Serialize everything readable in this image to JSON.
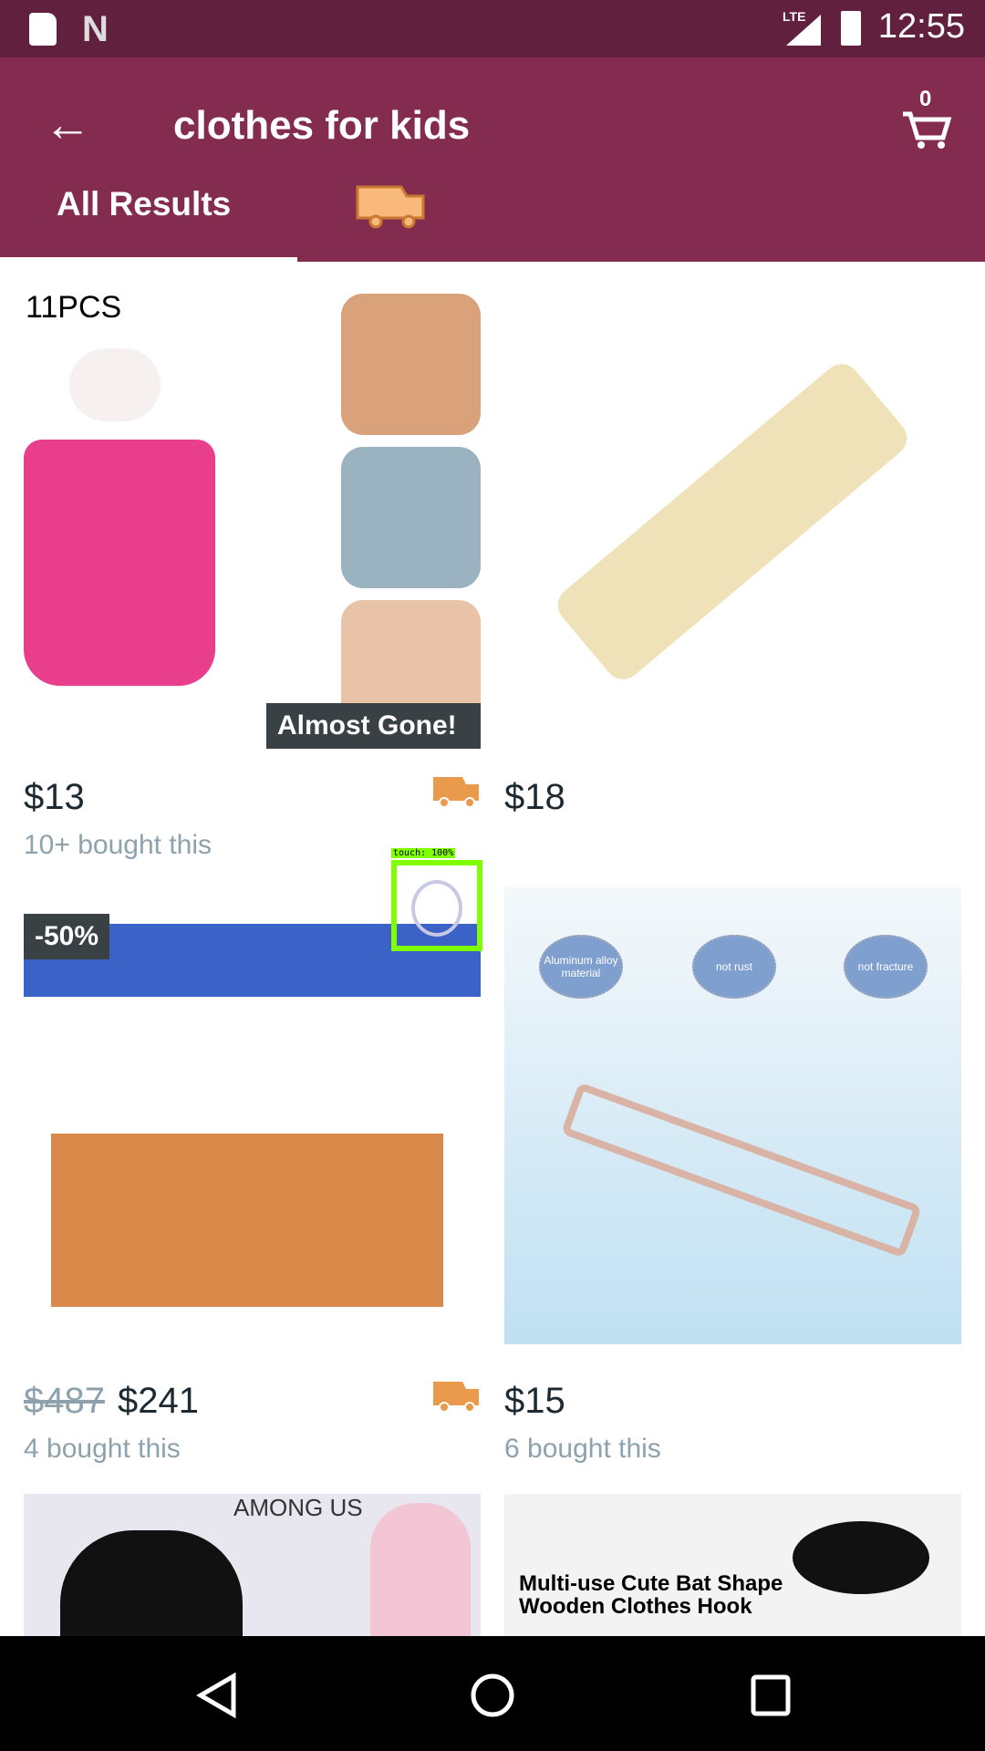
{
  "status_bar": {
    "time": "12:55",
    "network": "LTE"
  },
  "header": {
    "title": "clothes for kids",
    "cart_count": "0",
    "tabs": [
      {
        "label": "All Results",
        "active": true
      },
      {
        "icon": "fast-delivery-truck-icon"
      }
    ]
  },
  "colors": {
    "header": "#842b50",
    "status_bar": "#62203f",
    "truck": "#e99a4b"
  },
  "products": [
    {
      "image_text": "11PCS",
      "badge": "Almost Gone!",
      "price": "$13",
      "bought": "10+ bought this",
      "fast_shipping": true
    },
    {
      "price": "$18",
      "fast_shipping": false
    },
    {
      "badge": "-50%",
      "original_price": "$487",
      "price": "$241",
      "bought": "4 bought this",
      "fast_shipping": true
    },
    {
      "image_labels": [
        "Aluminum alloy material",
        "not rust",
        "not fracture"
      ],
      "price": "$15",
      "bought": "6 bought this",
      "fast_shipping": false
    },
    {
      "image_text": "AMONG US"
    },
    {
      "image_text": "Multi-use Cute Bat Shape Wooden Clothes Hook"
    }
  ],
  "overlay": {
    "touch_label": "touch: 100%"
  }
}
